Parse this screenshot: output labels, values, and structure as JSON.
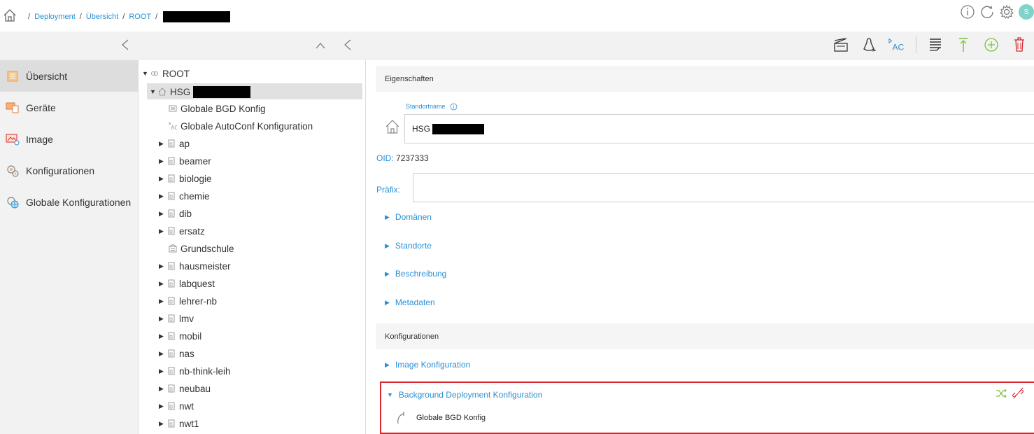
{
  "breadcrumb": {
    "items": [
      "Deployment",
      "Übersicht",
      "ROOT"
    ],
    "separator": "/"
  },
  "user": {
    "avatar_initial": "S"
  },
  "sidebar": {
    "items": [
      {
        "label": "Übersicht",
        "icon": "overview-icon",
        "active": true
      },
      {
        "label": "Geräte",
        "icon": "devices-icon"
      },
      {
        "label": "Image",
        "icon": "image-icon"
      },
      {
        "label": "Konfigurationen",
        "icon": "configurations-icon"
      },
      {
        "label": "Globale Konfigurationen",
        "icon": "global-configurations-icon"
      }
    ]
  },
  "toolbar": {
    "ac_label": "AC"
  },
  "tree": {
    "root": "ROOT",
    "site": "HSG",
    "global_bgd": "Globale BGD Konfig",
    "global_autoconf": "Globale AutoConf Konfiguration",
    "autoconf_prefix": "AC",
    "children": [
      "ap",
      "beamer",
      "biologie",
      "chemie",
      "dib",
      "ersatz",
      "Grundschule",
      "hausmeister",
      "labquest",
      "lehrer-nb",
      "lmv",
      "mobil",
      "nas",
      "nb-think-leih",
      "neubau",
      "nwt",
      "nwt1"
    ]
  },
  "main": {
    "properties_header": "Eigenschaften",
    "site_name_label": "Standortname",
    "site_name_value": "HSG",
    "oid_label": "OID:",
    "oid_value": "7237333",
    "prefix_label": "Präfix:",
    "prefix_value": "",
    "sections": [
      "Domänen",
      "Standorte",
      "Beschreibung",
      "Metadaten"
    ],
    "configurations_header": "Konfigurationen",
    "image_config": "Image Konfiguration",
    "bgd_config": "Background Deployment Konfiguration",
    "bgd_entry": "Globale BGD Konfig"
  },
  "colors": {
    "link": "#2a8fd4",
    "accent_green": "#7ac143",
    "danger": "#d9262e",
    "avatar": "#7fd3c8"
  }
}
